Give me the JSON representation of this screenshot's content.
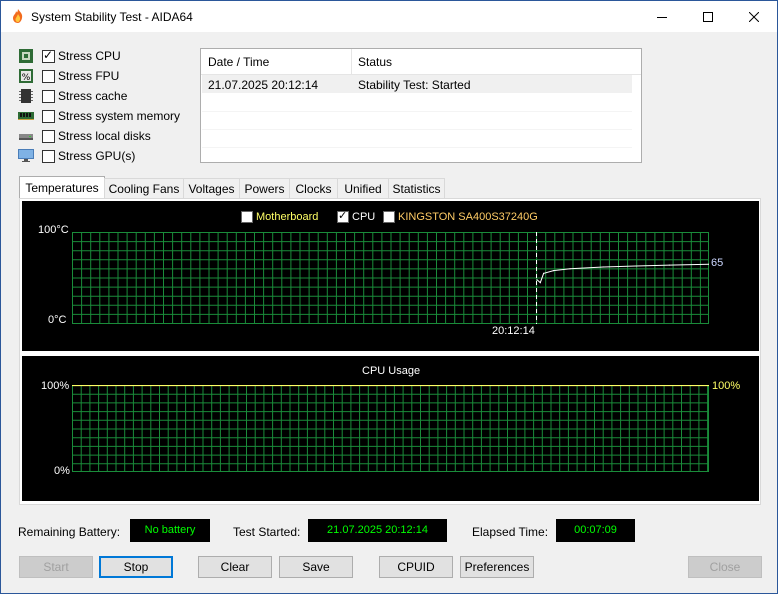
{
  "window": {
    "title": "System Stability Test - AIDA64"
  },
  "stress": [
    {
      "label": "Stress CPU",
      "checked": true,
      "icon": "cpu-chip-icon"
    },
    {
      "label": "Stress FPU",
      "checked": false,
      "icon": "fpu-percent-icon"
    },
    {
      "label": "Stress cache",
      "checked": false,
      "icon": "cache-icon"
    },
    {
      "label": "Stress system memory",
      "checked": false,
      "icon": "memory-module-icon"
    },
    {
      "label": "Stress local disks",
      "checked": false,
      "icon": "disk-drive-icon"
    },
    {
      "label": "Stress GPU(s)",
      "checked": false,
      "icon": "monitor-icon"
    }
  ],
  "log": {
    "col_datetime": "Date / Time",
    "col_status": "Status",
    "rows": [
      {
        "datetime": "21.07.2025 20:12:14",
        "status": "Stability Test: Started"
      }
    ]
  },
  "tabs": [
    "Temperatures",
    "Cooling Fans",
    "Voltages",
    "Powers",
    "Clocks",
    "Unified",
    "Statistics"
  ],
  "active_tab": "Temperatures",
  "temp_graph": {
    "legend": [
      {
        "label": "Motherboard",
        "checked": false,
        "color": "#ffff66"
      },
      {
        "label": "CPU",
        "checked": true,
        "color": "#ffffff"
      },
      {
        "label": "KINGSTON SA400S37240G",
        "checked": false,
        "color": "#ffcc66"
      }
    ],
    "y_max_label": "100°C",
    "y_min_label": "0°C",
    "time_label": "20:12:14",
    "current_value_label": "65",
    "grid_color": "#1a8c3a"
  },
  "usage_graph": {
    "title": "CPU Usage",
    "y_max_label": "100%",
    "y_min_label": "0%",
    "current_value_label": "100%",
    "line_color": "#ffff66",
    "grid_color": "#1a8c3a"
  },
  "chart_data": [
    {
      "type": "line",
      "series": [
        {
          "name": "CPU",
          "x": [
            0,
            1,
            2,
            5,
            10,
            20,
            30,
            40,
            52
          ],
          "values": [
            48,
            45,
            55,
            58,
            60,
            62,
            63,
            64,
            65
          ]
        }
      ],
      "ylim": [
        0,
        100
      ]
    },
    {
      "type": "line",
      "title": "CPU Usage",
      "series": [
        {
          "name": "CPU Usage",
          "x": [
            0,
            66
          ],
          "values": [
            100,
            100
          ]
        }
      ],
      "ylim": [
        0,
        100
      ]
    }
  ],
  "status": {
    "battery_label": "Remaining Battery:",
    "battery_value": "No battery",
    "started_label": "Test Started:",
    "started_value": "21.07.2025 20:12:14",
    "elapsed_label": "Elapsed Time:",
    "elapsed_value": "00:07:09"
  },
  "buttons": {
    "start": "Start",
    "stop": "Stop",
    "clear": "Clear",
    "save": "Save",
    "cpuid": "CPUID",
    "preferences": "Preferences",
    "close": "Close"
  }
}
